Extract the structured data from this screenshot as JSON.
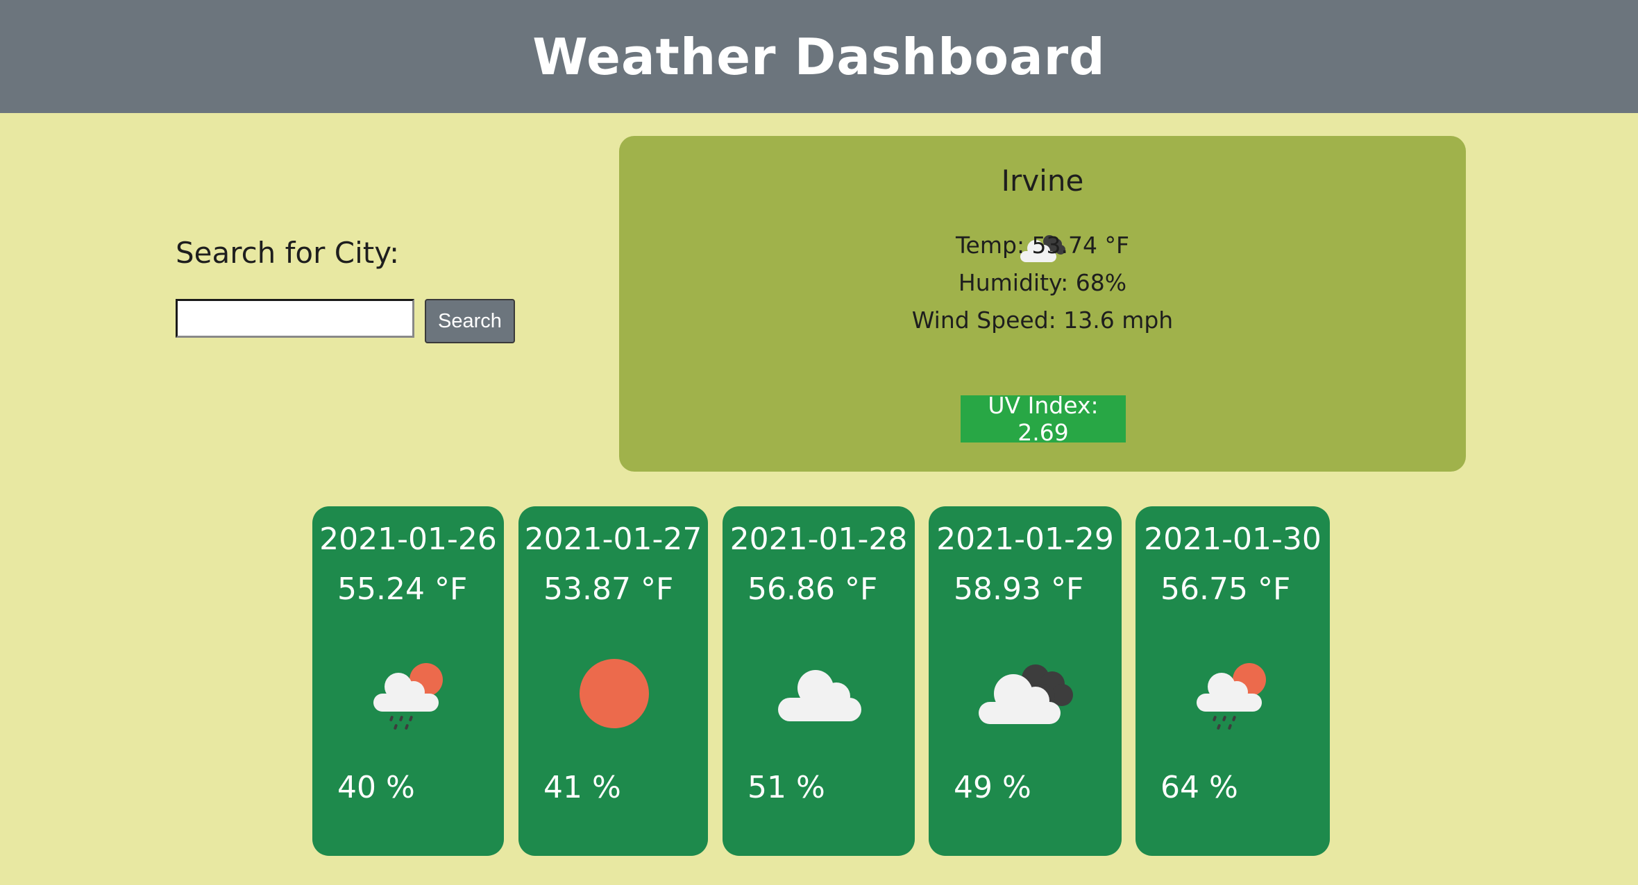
{
  "header": {
    "title": "Weather Dashboard"
  },
  "search": {
    "label": "Search for City:",
    "value": "",
    "placeholder": "",
    "button_label": "Search"
  },
  "current": {
    "city": "Irvine",
    "icon": "cloud-night-icon",
    "temp": "Temp: 53.74 °F",
    "humidity": "Humidity: 68%",
    "wind": "Wind Speed: 13.6 mph",
    "uv": "UV Index: 2.69",
    "uv_color": "#28a745"
  },
  "forecast": [
    {
      "date": "2021-01-26",
      "temp": "55.24 °F",
      "humidity": "40 %",
      "icon": "rain-sun-icon"
    },
    {
      "date": "2021-01-27",
      "temp": "53.87 °F",
      "humidity": "41 %",
      "icon": "sun-icon"
    },
    {
      "date": "2021-01-28",
      "temp": "56.86 °F",
      "humidity": "51 %",
      "icon": "cloud-icon"
    },
    {
      "date": "2021-01-29",
      "temp": "58.93 °F",
      "humidity": "49 %",
      "icon": "cloud-dark-icon"
    },
    {
      "date": "2021-01-30",
      "temp": "56.75 °F",
      "humidity": "64 %",
      "icon": "rain-sun-icon"
    }
  ],
  "colors": {
    "header": "#6c757d",
    "background": "#e8e8a2",
    "current_panel": "#a0b24b",
    "card": "#1e8a4c",
    "sun": "#ec6a4c"
  }
}
